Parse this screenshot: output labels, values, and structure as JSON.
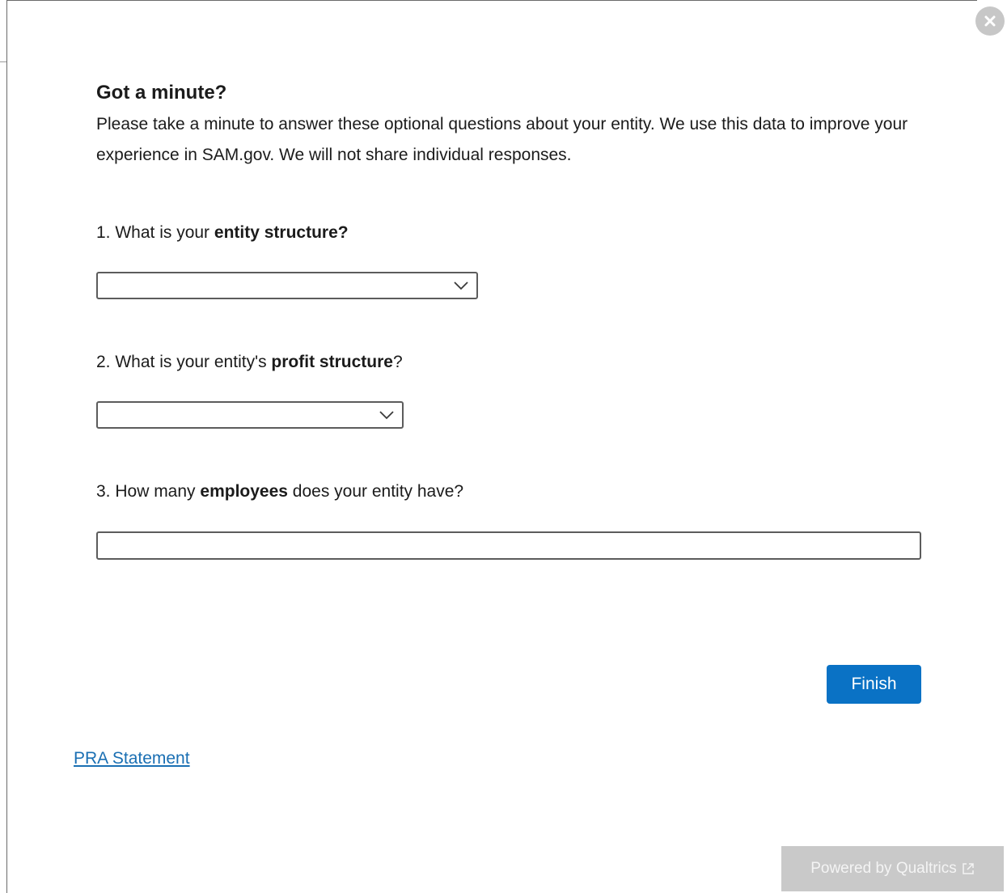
{
  "survey": {
    "title": "Got a minute?",
    "intro": "Please take a minute to answer these optional questions about your entity. We use this data to improve your experience in SAM.gov. We will not share individual responses.",
    "questions": [
      {
        "prefix": "1. What is your ",
        "bold": "entity structure?",
        "suffix": "",
        "input_type": "select",
        "selected_value": ""
      },
      {
        "prefix": "2. What is your entity's ",
        "bold": "profit structure",
        "suffix": "?",
        "input_type": "select",
        "selected_value": ""
      },
      {
        "prefix": "3. How many ",
        "bold": "employees",
        "suffix": " does your entity have?",
        "input_type": "text",
        "value": ""
      }
    ],
    "finish_label": "Finish",
    "pra_link": "PRA Statement",
    "powered_by": "Powered by Qualtrics"
  },
  "icons": {
    "close": "close-icon",
    "chevron": "chevron-down-icon",
    "external": "external-link-icon"
  },
  "colors": {
    "primary_button": "#0a72c5",
    "link": "#1a6fb3",
    "badge_bg": "#c9c9c9",
    "close_bg": "#c7c7c7"
  }
}
